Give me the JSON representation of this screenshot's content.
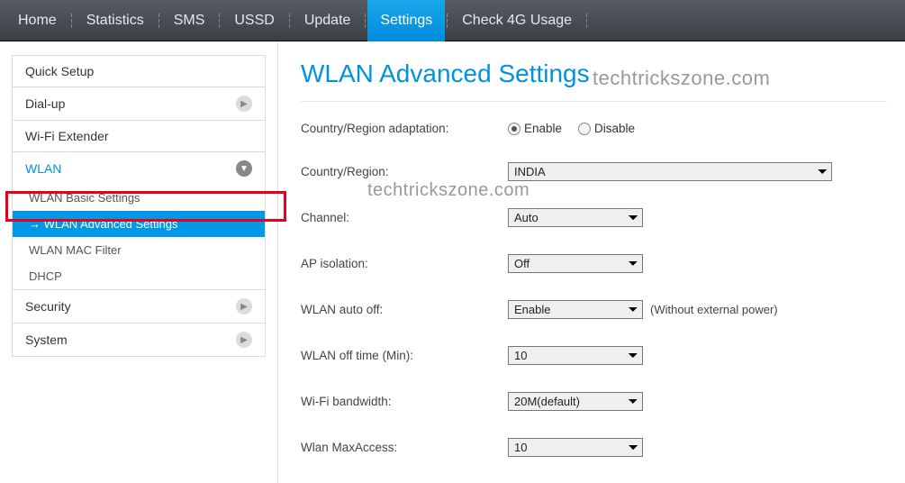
{
  "topnav": {
    "items": [
      {
        "label": "Home"
      },
      {
        "label": "Statistics"
      },
      {
        "label": "SMS"
      },
      {
        "label": "USSD"
      },
      {
        "label": "Update"
      },
      {
        "label": "Settings",
        "active": true
      },
      {
        "label": "Check 4G Usage"
      }
    ]
  },
  "sidebar": {
    "quick_setup": "Quick Setup",
    "dial_up": "Dial-up",
    "wifi_extender": "Wi-Fi Extender",
    "wlan": "WLAN",
    "wlan_sub": {
      "basic": "WLAN Basic Settings",
      "advanced": "WLAN Advanced Settings",
      "mac_filter": "WLAN MAC Filter",
      "dhcp": "DHCP"
    },
    "security": "Security",
    "system": "System"
  },
  "main": {
    "title": "WLAN Advanced Settings",
    "watermark": "techtrickszone.com",
    "form": {
      "country_adapt_label": "Country/Region adaptation:",
      "country_adapt_enable": "Enable",
      "country_adapt_disable": "Disable",
      "country_label": "Country/Region:",
      "country_value": "INDIA",
      "channel_label": "Channel:",
      "channel_value": "Auto",
      "ap_iso_label": "AP isolation:",
      "ap_iso_value": "Off",
      "auto_off_label": "WLAN auto off:",
      "auto_off_value": "Enable",
      "auto_off_note": "(Without external power)",
      "off_time_label": "WLAN off time (Min):",
      "off_time_value": "10",
      "bandwidth_label": "Wi-Fi bandwidth:",
      "bandwidth_value": "20M(default)",
      "max_access_label": "Wlan MaxAccess:",
      "max_access_value": "10"
    }
  }
}
